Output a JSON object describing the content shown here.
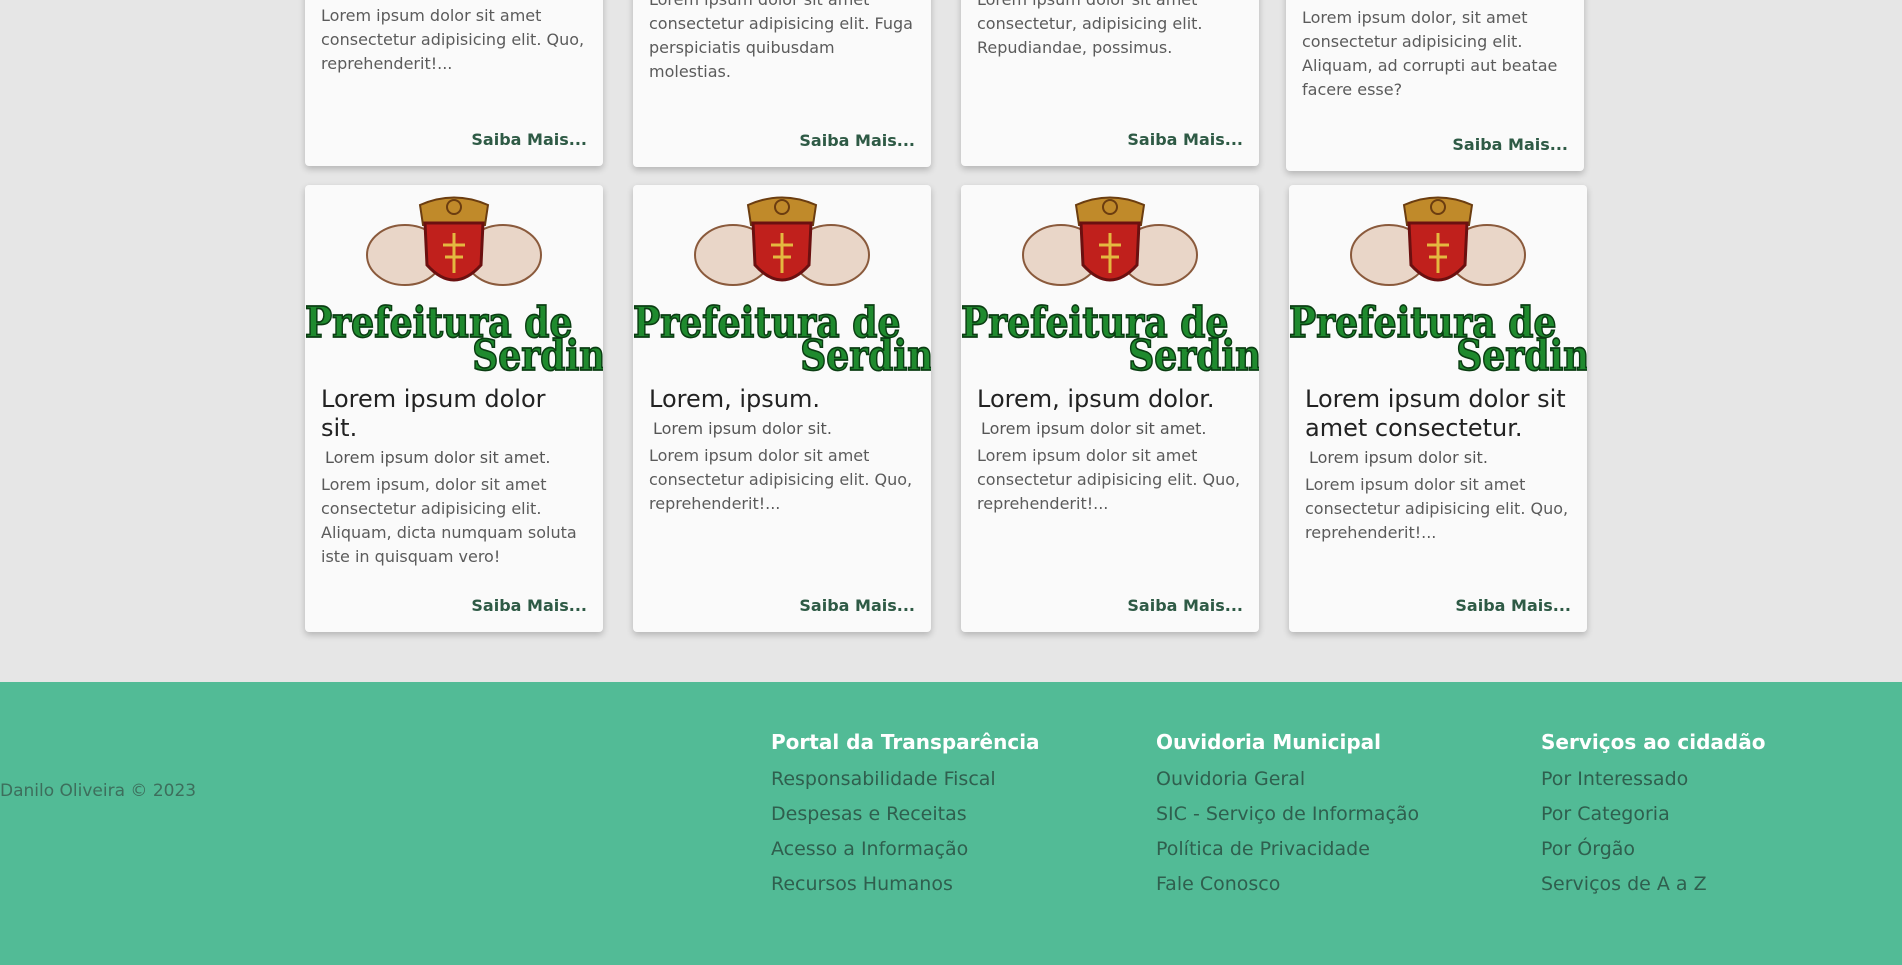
{
  "top_cards": [
    {
      "text": "Lorem ipsum dolor sit amet consectetur adipisicing elit. Quo, reprehenderit!...",
      "more": "Saiba Mais..."
    },
    {
      "text": "Lorem ipsum dolor sit amet consectetur adipisicing elit. Fuga perspiciatis quibusdam molestias.",
      "more": "Saiba Mais..."
    },
    {
      "text": "Lorem ipsum dolor sit amet consectetur, adipisicing elit. Repudiandae, possimus.",
      "more": "Saiba Mais..."
    },
    {
      "text": "Lorem ipsum dolor, sit amet consectetur adipisicing elit. Aliquam, ad corrupti aut beatae facere esse?",
      "more": "Saiba Mais..."
    }
  ],
  "cards": [
    {
      "logo": "Prefeitura de Serdin",
      "title": "Lorem ipsum dolor sit.",
      "subtitle": "Lorem ipsum dolor sit amet.",
      "text": "Lorem ipsum, dolor sit amet consectetur adipisicing elit. Aliquam, dicta numquam soluta iste in quisquam vero!",
      "more": "Saiba Mais..."
    },
    {
      "logo": "Prefeitura de Serdin",
      "title": "Lorem, ipsum.",
      "subtitle": "Lorem ipsum dolor sit.",
      "text": "Lorem ipsum dolor sit amet consectetur adipisicing elit. Quo, reprehenderit!...",
      "more": "Saiba Mais..."
    },
    {
      "logo": "Prefeitura de Serdin",
      "title": "Lorem, ipsum dolor.",
      "subtitle": "Lorem ipsum dolor sit amet.",
      "text": "Lorem ipsum dolor sit amet consectetur adipisicing elit. Quo, reprehenderit!...",
      "more": "Saiba Mais..."
    },
    {
      "logo": "Prefeitura de Serdin",
      "title": "Lorem ipsum dolor sit amet consectetur.",
      "subtitle": "Lorem ipsum dolor sit.",
      "text": "Lorem ipsum dolor sit amet consectetur adipisicing elit. Quo, reprehenderit!...",
      "more": "Saiba Mais..."
    }
  ],
  "footer": {
    "copyright": "Danilo Oliveira © 2023",
    "columns": [
      {
        "heading": "Portal da Transparência",
        "links": [
          "Responsabilidade Fiscal",
          "Despesas e Receitas",
          "Acesso a Informação",
          "Recursos Humanos"
        ]
      },
      {
        "heading": "Ouvidoria Municipal",
        "links": [
          "Ouvidoria Geral",
          "SIC - Serviço de Informação",
          "Política de Privacidade",
          "Fale Conosco"
        ]
      },
      {
        "heading": "Serviços ao cidadão",
        "links": [
          "Por Interessado",
          "Por Categoria",
          "Por Órgão",
          "Serviços de A a Z"
        ]
      }
    ]
  },
  "colors": {
    "background": "#e6e6e6",
    "card": "#fafafa",
    "footer": "#52bb96",
    "link_more": "#2e5a45",
    "logo_green": "#1f8a2e",
    "shield_red": "#c0201c",
    "gold": "#c08a2a"
  }
}
